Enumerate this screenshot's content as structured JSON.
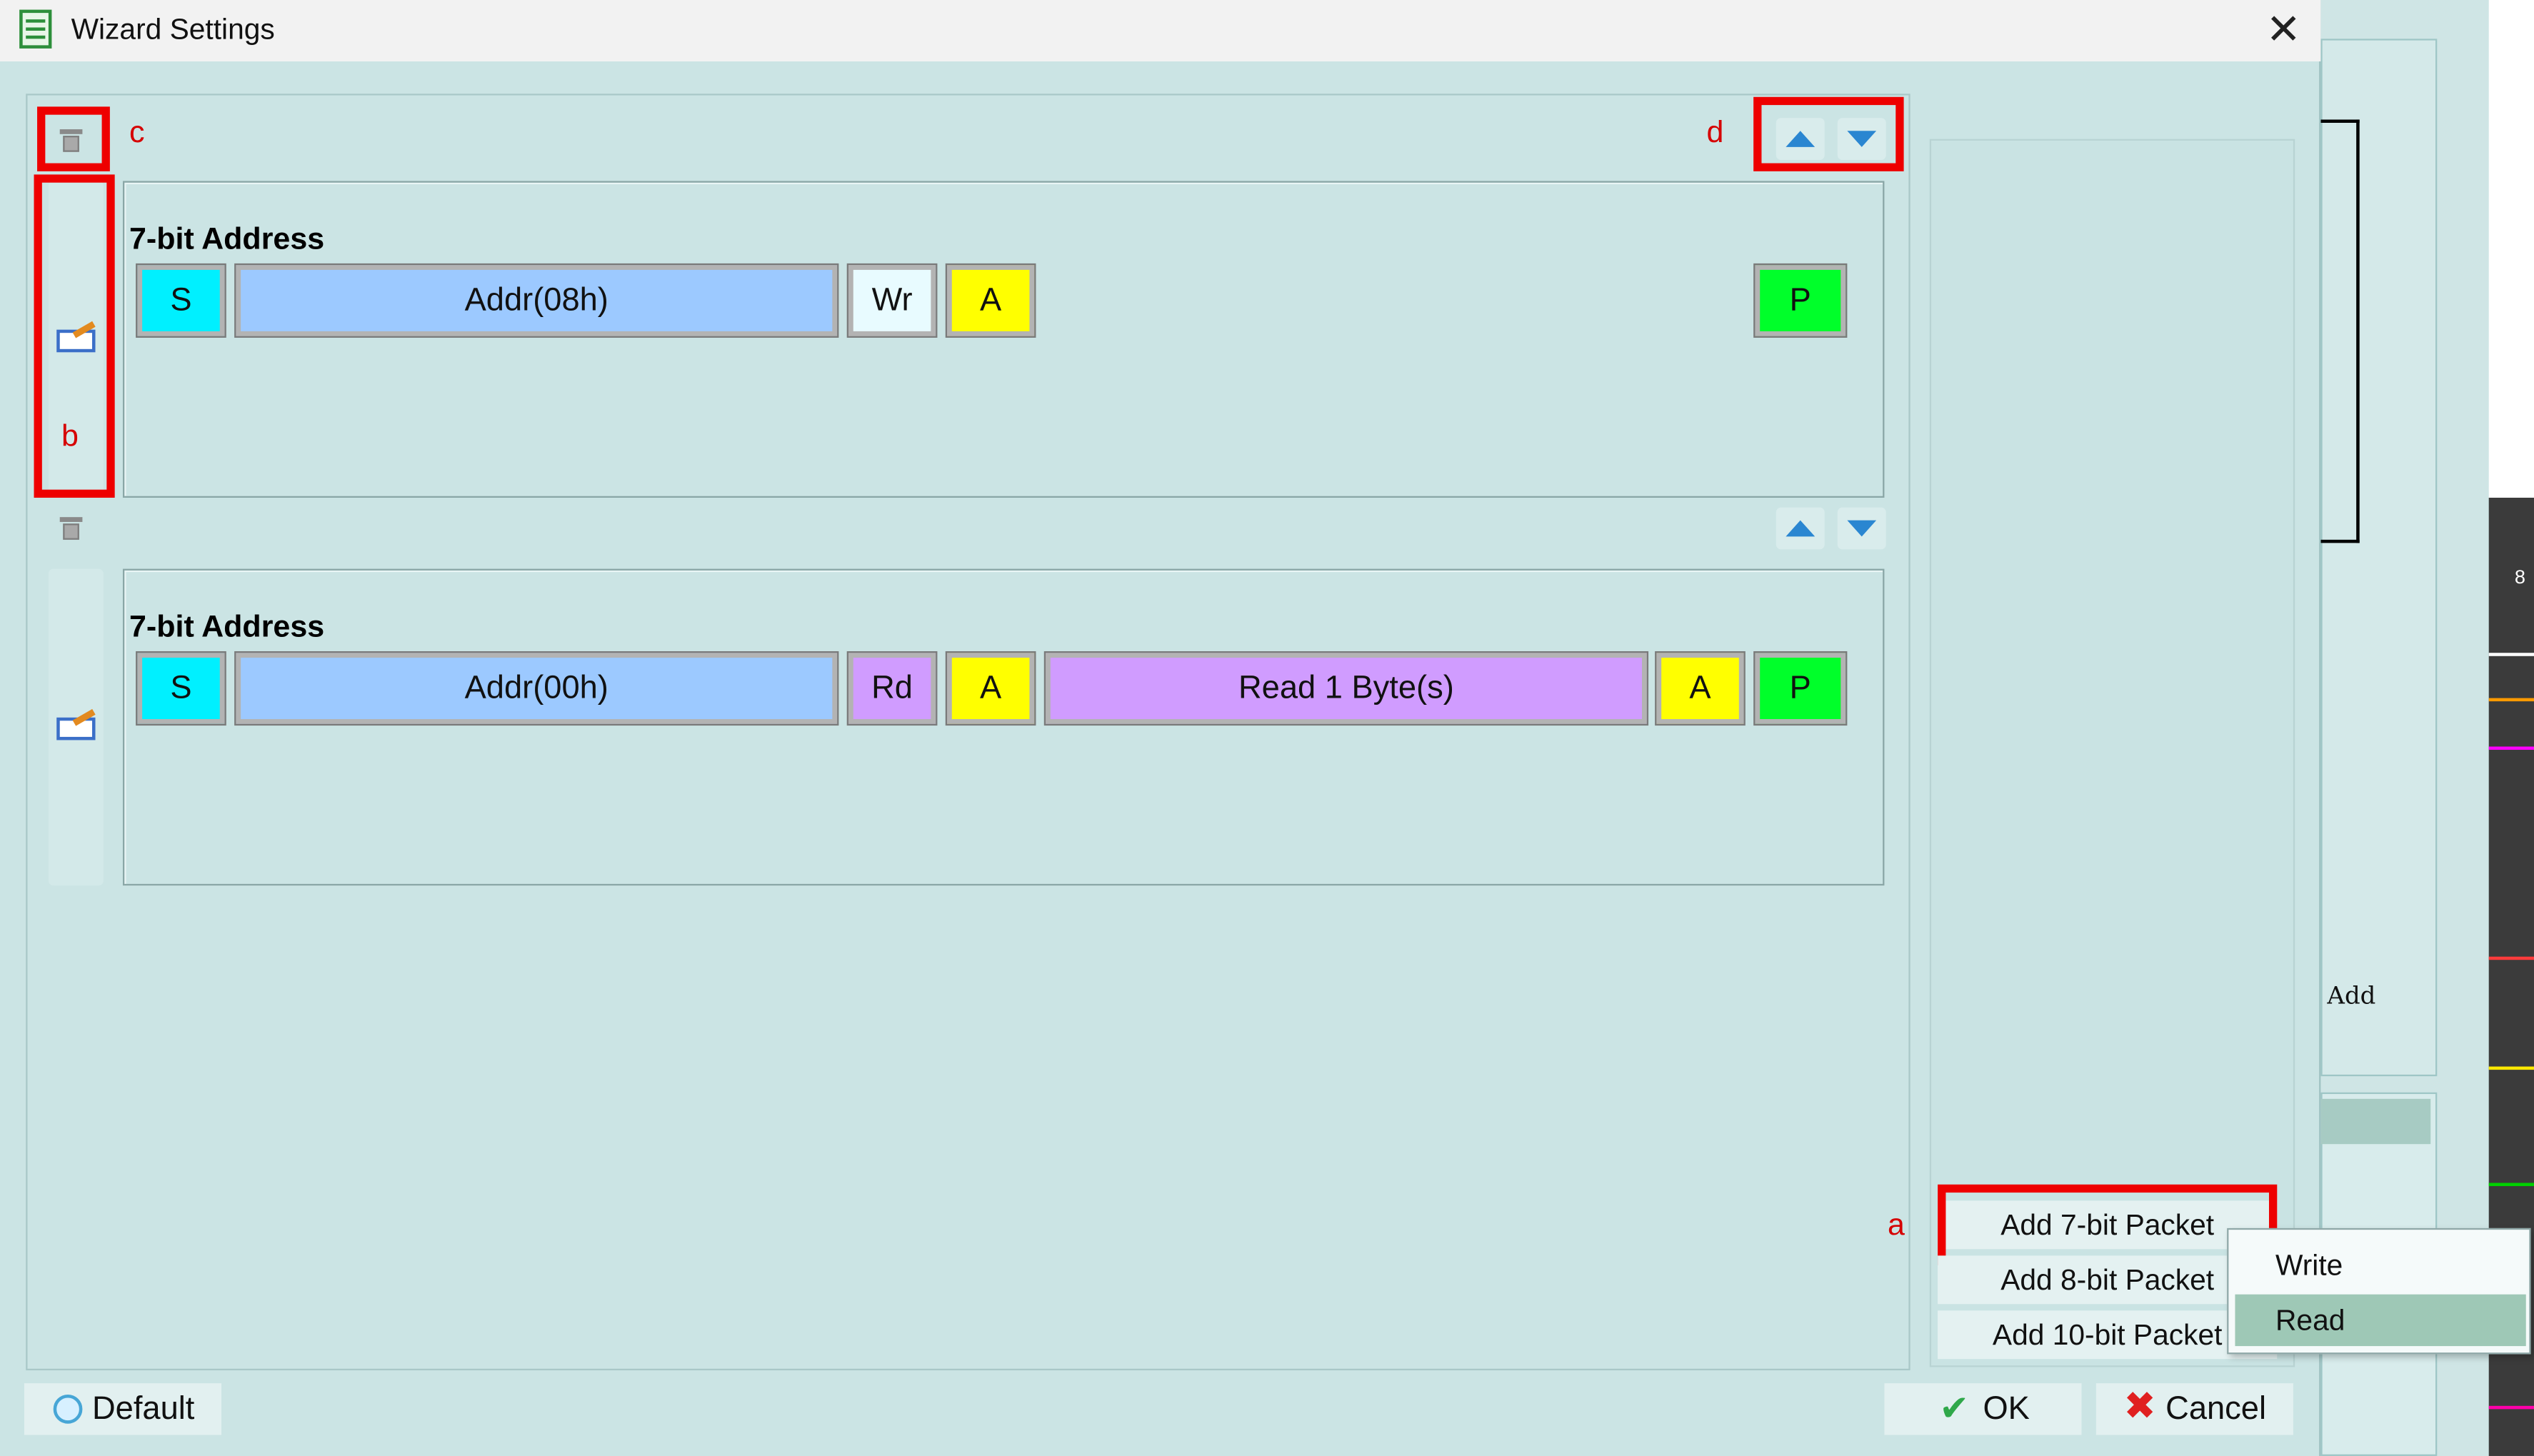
{
  "window": {
    "title": "Wizard Settings"
  },
  "background_app": {
    "add_label": "Add",
    "side_number": "8"
  },
  "annotations": {
    "a": "a",
    "b": "b",
    "c": "c",
    "d": "d"
  },
  "packets": [
    {
      "title": "7-bit Address",
      "fields": [
        {
          "label": "S",
          "color": "#00f0ff"
        },
        {
          "label": "Addr(08h)",
          "color": "#9cc9ff"
        },
        {
          "label": "Wr",
          "color": "#e8fbff"
        },
        {
          "label": "A",
          "color": "#ffff00"
        },
        {
          "label": "P",
          "color": "#00ff2a"
        }
      ]
    },
    {
      "title": "7-bit Address",
      "fields": [
        {
          "label": "S",
          "color": "#00f0ff"
        },
        {
          "label": "Addr(00h)",
          "color": "#9cc9ff"
        },
        {
          "label": "Rd",
          "color": "#d09cff"
        },
        {
          "label": "A",
          "color": "#ffff00"
        },
        {
          "label": "Read 1 Byte(s)",
          "color": "#d09cff"
        },
        {
          "label": "A",
          "color": "#ffff00"
        },
        {
          "label": "P",
          "color": "#00ff2a"
        }
      ]
    }
  ],
  "add_buttons": [
    "Add 7-bit Packet",
    "Add 8-bit Packet",
    "Add 10-bit Packet"
  ],
  "dropdown": {
    "items": [
      "Write",
      "Read"
    ],
    "selected": "Read"
  },
  "footer": {
    "default_label": "Default",
    "ok_label": "OK",
    "cancel_label": "Cancel"
  },
  "icons": {
    "title": "wizard-document-icon",
    "close": "close-icon",
    "delete": "trash-icon",
    "edit": "edit-icon",
    "up": "arrow-up-icon",
    "down": "arrow-down-icon"
  }
}
